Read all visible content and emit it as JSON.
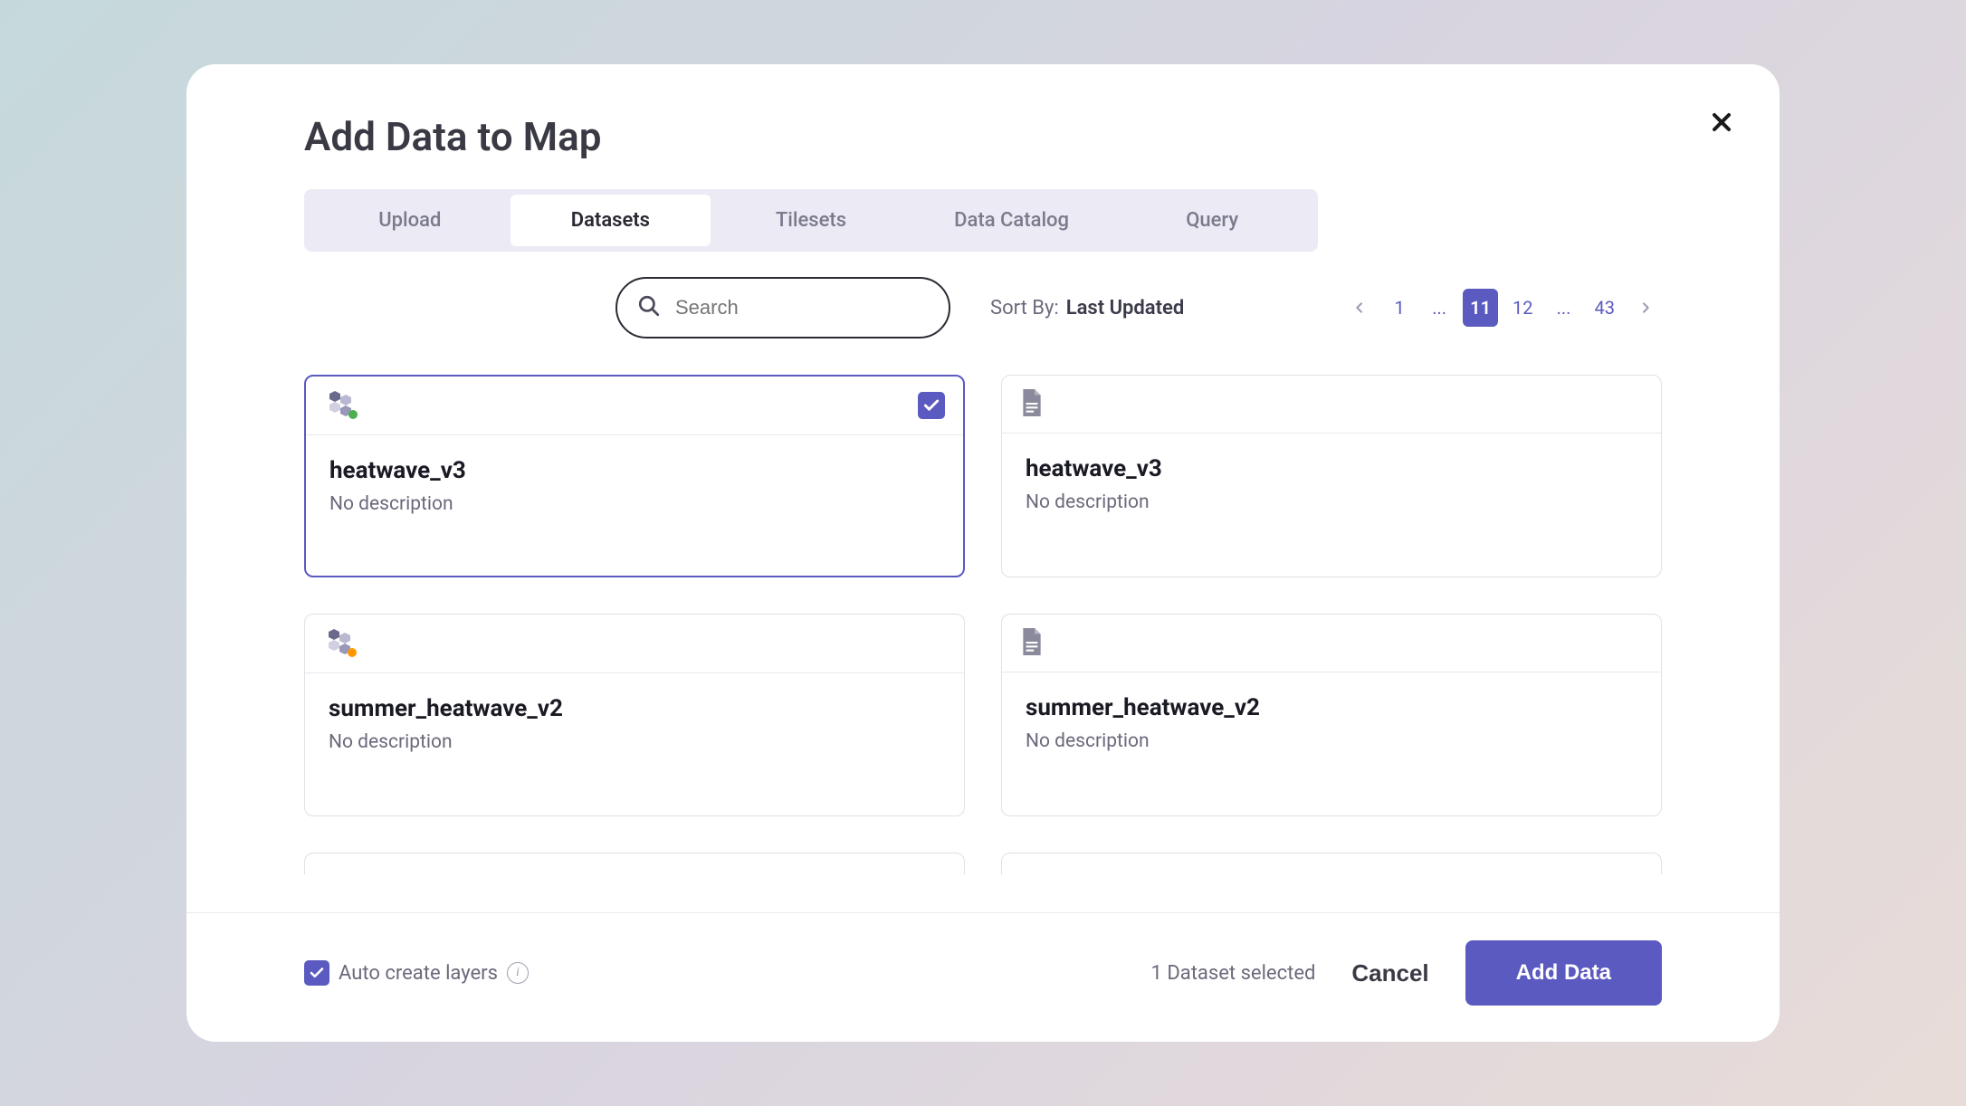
{
  "modal": {
    "title": "Add Data to Map"
  },
  "tabs": [
    {
      "label": "Upload",
      "active": false
    },
    {
      "label": "Datasets",
      "active": true
    },
    {
      "label": "Tilesets",
      "active": false
    },
    {
      "label": "Data Catalog",
      "active": false
    },
    {
      "label": "Query",
      "active": false
    }
  ],
  "search": {
    "placeholder": "Search"
  },
  "sort": {
    "label": "Sort By:",
    "value": "Last Updated"
  },
  "pagination": {
    "pages": [
      "1",
      "...",
      "11",
      "12",
      "...",
      "43"
    ],
    "active": "11"
  },
  "cards": [
    {
      "title": "heatwave_v3",
      "description": "No description",
      "selected": true,
      "iconType": "hex",
      "accent": "#4caf50"
    },
    {
      "title": "heatwave_v3",
      "description": "No description",
      "selected": false,
      "iconType": "file",
      "accent": ""
    },
    {
      "title": "summer_heatwave_v2",
      "description": "No description",
      "selected": false,
      "iconType": "hex",
      "accent": "#ff9800"
    },
    {
      "title": "summer_heatwave_v2",
      "description": "No description",
      "selected": false,
      "iconType": "file",
      "accent": ""
    }
  ],
  "footer": {
    "autoCreateLabel": "Auto create layers",
    "selectionText": "1 Dataset selected",
    "cancelLabel": "Cancel",
    "addDataLabel": "Add Data"
  }
}
